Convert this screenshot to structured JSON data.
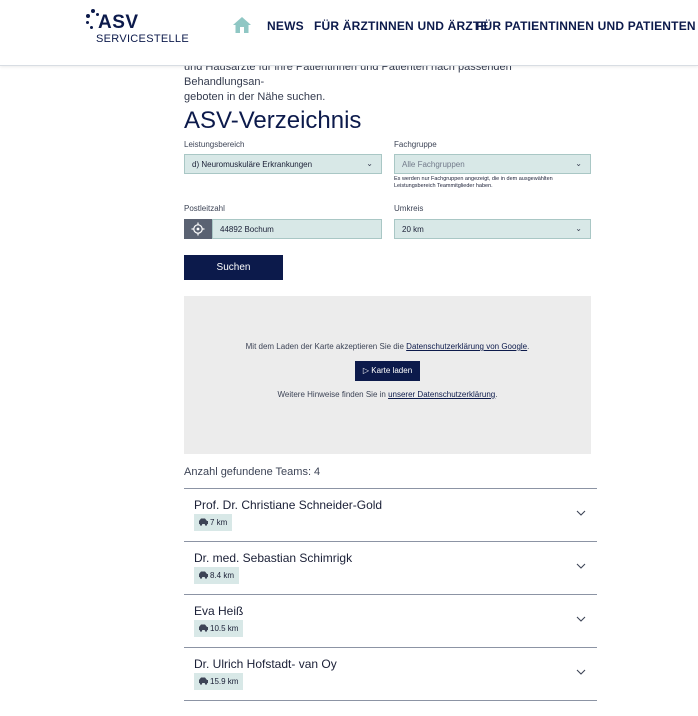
{
  "header": {
    "logo_title": "ASV",
    "logo_subtitle": "SERVICESTELLE",
    "nav": [
      "NEWS",
      "FÜR ÄRZTINNEN UND ÄRZTE",
      "FÜR PATIENTINNEN UND PATIENTEN"
    ]
  },
  "intro": {
    "line1": "und Hausärzte für ihre Patientinnen und Patienten nach passenden Behandlungsan-",
    "line2": "geboten in der Nähe suchen."
  },
  "title": "ASV-Verzeichnis",
  "form": {
    "leistungsbereich_label": "Leistungsbereich",
    "leistungsbereich_value": "d) Neuromuskuläre Erkrankungen",
    "fachgruppe_label": "Fachgruppe",
    "fachgruppe_value": "Alle Fachgruppen",
    "fachgruppe_hint": "Es werden nur Fachgruppen angezeigt, die in dem ausgewählten Leistungsbereich Teammitglieder haben.",
    "postleitzahl_label": "Postleitzahl",
    "postleitzahl_value": "44892 Bochum",
    "umkreis_label": "Umkreis",
    "umkreis_value": "20 km",
    "search_label": "Suchen"
  },
  "map": {
    "consent_text": "Mit dem Laden der Karte akzeptieren Sie die ",
    "consent_link": "Datenschutzerklärung von Google",
    "consent_end": ".",
    "load_button": "Karte laden",
    "notes_text": "Weitere Hinweise finden Sie in ",
    "notes_link": "unserer Datenschutzerklärung",
    "notes_end": "."
  },
  "result_count": "Anzahl gefundene Teams: 4",
  "results": [
    {
      "name": "Prof. Dr. Christiane Schneider-Gold",
      "distance": "7 km"
    },
    {
      "name": "Dr. med. Sebastian Schimrigk",
      "distance": "8.4 km"
    },
    {
      "name": "Eva Heiß",
      "distance": "10.5 km"
    },
    {
      "name": "Dr. Ulrich Hofstadt- van Oy",
      "distance": "15.9 km"
    }
  ],
  "colors": {
    "brand": "#0c1a4b",
    "field_bg": "#d8e8e7",
    "home_icon": "#8fc7c4"
  },
  "icons": {
    "home": "home-icon",
    "location": "target-icon",
    "car": "car-icon",
    "expand": "chevron-down-icon",
    "play": "play-icon"
  }
}
